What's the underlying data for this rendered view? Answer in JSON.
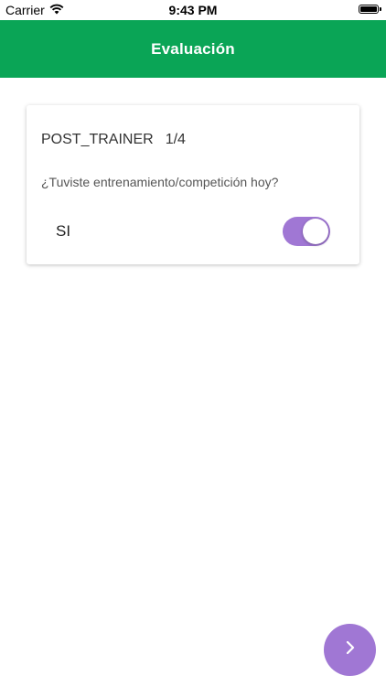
{
  "status_bar": {
    "carrier": "Carrier",
    "time": "9:43 PM",
    "icons": [
      "wifi-icon",
      "battery-icon"
    ]
  },
  "header": {
    "title": "Evaluación",
    "background_color": "#0aa556"
  },
  "card": {
    "code": "POST_TRAINER",
    "progress": "1/4",
    "question": "¿Tuviste entrenamiento/competición hoy?",
    "answer_label": "SI",
    "toggle_on": true,
    "toggle_color": "#a077d4"
  },
  "fab": {
    "icon": "chevron-right-icon",
    "color": "#a077d4"
  }
}
